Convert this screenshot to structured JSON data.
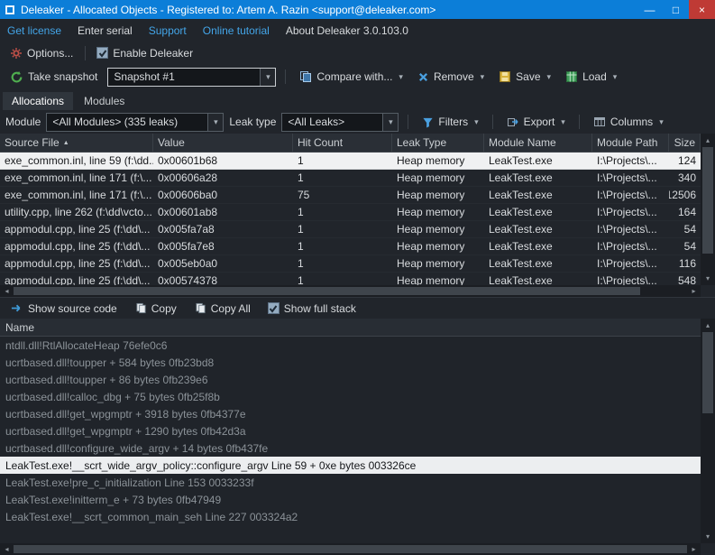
{
  "window": {
    "title": "Deleaker - Allocated Objects - Registered to: Artem A. Razin <support@deleaker.com>"
  },
  "icons": {
    "minimize": "—",
    "maximize": "□",
    "close": "×",
    "chevron": "▾",
    "sort_asc": "▲",
    "up": "▴",
    "down": "▾",
    "left": "◂",
    "right": "▸"
  },
  "menu": {
    "items": [
      {
        "label": "Get license"
      },
      {
        "label": "Enter serial"
      },
      {
        "label": "Support"
      },
      {
        "label": "Online tutorial"
      },
      {
        "label": "About Deleaker 3.0.103.0"
      }
    ]
  },
  "toolbar_options": {
    "options": "Options...",
    "enable": "Enable Deleaker",
    "enable_checked": true
  },
  "toolbar_snapshot": {
    "take_snapshot": "Take snapshot",
    "snapshot_value": "Snapshot #1",
    "compare": "Compare with...",
    "remove": "Remove",
    "save": "Save",
    "load": "Load"
  },
  "tabs": {
    "allocations": "Allocations",
    "modules": "Modules",
    "active": "Allocations"
  },
  "filterbar": {
    "module_label": "Module",
    "module_value": "<All Modules> (335 leaks)",
    "leak_label": "Leak type",
    "leak_value": "<All Leaks>",
    "filters": "Filters",
    "export": "Export",
    "columns": "Columns"
  },
  "alloc_table": {
    "columns": [
      "Source File",
      "Value",
      "Hit Count",
      "Leak Type",
      "Module Name",
      "Module Path",
      "Size"
    ],
    "rows": [
      {
        "source": "exe_common.inl, line 59 (f:\\dd...",
        "value": "0x00601b68",
        "hits": "1",
        "leak_type": "Heap memory",
        "module": "LeakTest.exe",
        "path": "I:\\Projects\\...",
        "size": "124",
        "selected": true
      },
      {
        "source": "exe_common.inl, line 171 (f:\\...",
        "value": "0x00606a28",
        "hits": "1",
        "leak_type": "Heap memory",
        "module": "LeakTest.exe",
        "path": "I:\\Projects\\...",
        "size": "340",
        "selected": false
      },
      {
        "source": "exe_common.inl, line 171 (f:\\...",
        "value": "0x00606ba0",
        "hits": "75",
        "leak_type": "Heap memory",
        "module": "LeakTest.exe",
        "path": "I:\\Projects\\...",
        "size": "12506",
        "selected": false
      },
      {
        "source": "utility.cpp, line 262 (f:\\dd\\vcto...",
        "value": "0x00601ab8",
        "hits": "1",
        "leak_type": "Heap memory",
        "module": "LeakTest.exe",
        "path": "I:\\Projects\\...",
        "size": "164",
        "selected": false
      },
      {
        "source": "appmodul.cpp, line 25 (f:\\dd\\...",
        "value": "0x005fa7a8",
        "hits": "1",
        "leak_type": "Heap memory",
        "module": "LeakTest.exe",
        "path": "I:\\Projects\\...",
        "size": "54",
        "selected": false
      },
      {
        "source": "appmodul.cpp, line 25 (f:\\dd\\...",
        "value": "0x005fa7e8",
        "hits": "1",
        "leak_type": "Heap memory",
        "module": "LeakTest.exe",
        "path": "I:\\Projects\\...",
        "size": "54",
        "selected": false
      },
      {
        "source": "appmodul.cpp, line 25 (f:\\dd\\...",
        "value": "0x005eb0a0",
        "hits": "1",
        "leak_type": "Heap memory",
        "module": "LeakTest.exe",
        "path": "I:\\Projects\\...",
        "size": "116",
        "selected": false
      },
      {
        "source": "appmodul.cpp, line 25 (f:\\dd\\...",
        "value": "0x00574378",
        "hits": "1",
        "leak_type": "Heap memory",
        "module": "LeakTest.exe",
        "path": "I:\\Projects\\...",
        "size": "548",
        "selected": false
      }
    ]
  },
  "stack_toolbar": {
    "show_source": "Show source code",
    "copy": "Copy",
    "copy_all": "Copy All",
    "full_stack": "Show full stack",
    "full_stack_checked": true
  },
  "stack": {
    "header": "Name",
    "frames": [
      {
        "text": "ntdll.dll!RtlAllocateHeap 76efe0c6",
        "selected": false
      },
      {
        "text": "ucrtbased.dll!toupper + 584 bytes 0fb23bd8",
        "selected": false
      },
      {
        "text": "ucrtbased.dll!toupper + 86 bytes 0fb239e6",
        "selected": false
      },
      {
        "text": "ucrtbased.dll!calloc_dbg + 75 bytes 0fb25f8b",
        "selected": false
      },
      {
        "text": "ucrtbased.dll!get_wpgmptr + 3918 bytes 0fb4377e",
        "selected": false
      },
      {
        "text": "ucrtbased.dll!get_wpgmptr + 1290 bytes 0fb42d3a",
        "selected": false
      },
      {
        "text": "ucrtbased.dll!configure_wide_argv + 14 bytes 0fb437fe",
        "selected": false
      },
      {
        "text": "LeakTest.exe!__scrt_wide_argv_policy::configure_argv Line 59 + 0xe bytes 003326ce",
        "selected": true
      },
      {
        "text": "LeakTest.exe!pre_c_initialization Line 153 0033233f",
        "selected": false
      },
      {
        "text": "LeakTest.exe!initterm_e + 73 bytes 0fb47949",
        "selected": false
      },
      {
        "text": "LeakTest.exe!__scrt_common_main_seh Line 227 003324a2",
        "selected": false
      }
    ]
  }
}
